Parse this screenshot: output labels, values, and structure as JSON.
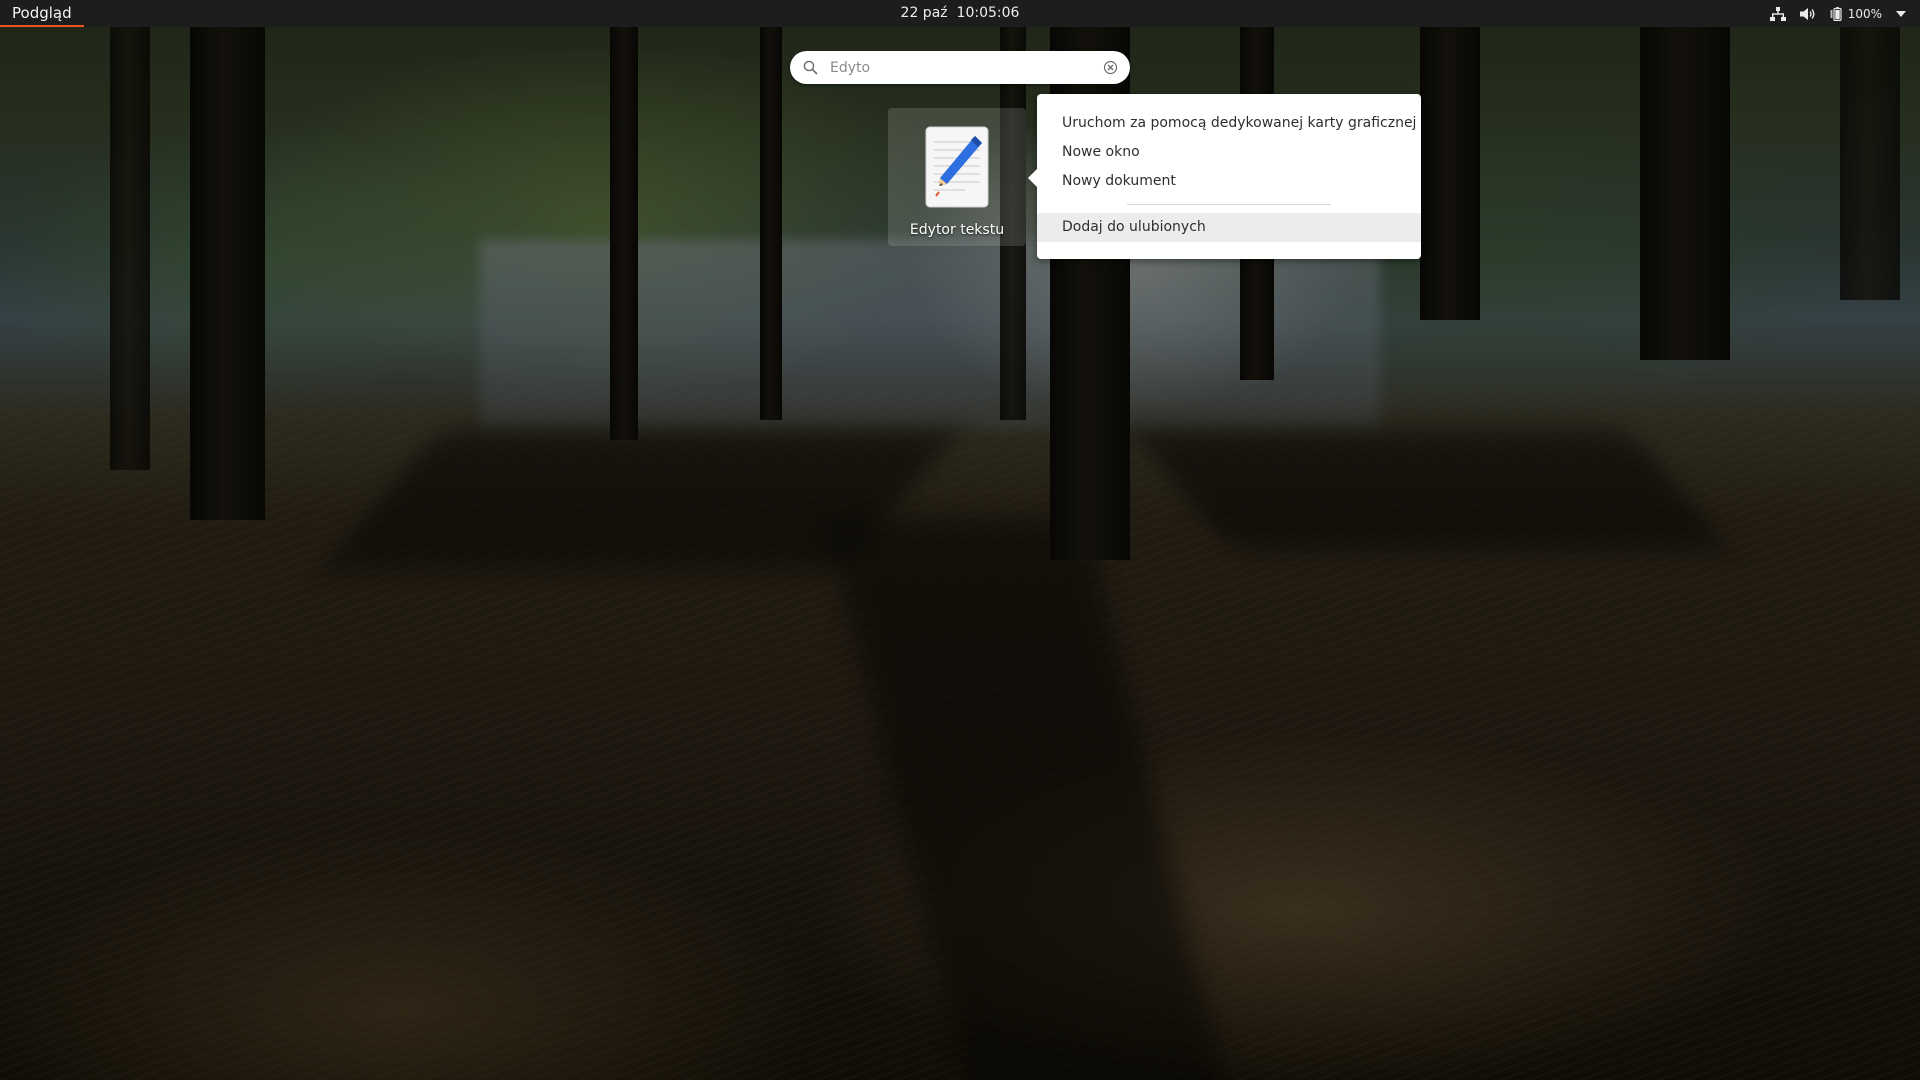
{
  "topbar": {
    "activities_label": "Podgląd",
    "clock_date": "22 paź",
    "clock_time": "10:05:06",
    "battery_percent": "100%",
    "icons": [
      "network-icon",
      "volume-icon",
      "battery-icon",
      "system-menu-arrow-icon"
    ]
  },
  "search": {
    "value": "Edyto",
    "icons": [
      "search-icon",
      "clear-icon"
    ]
  },
  "results": [
    {
      "label": "Edytor tekstu",
      "icon": "text-editor-icon"
    }
  ],
  "context_menu": {
    "items": [
      "Uruchom za pomocą dedykowanej karty graficznej",
      "Nowe okno",
      "Nowy dokument"
    ],
    "after_separator": [
      "Dodaj do ulubionych"
    ],
    "hovered_item": "Dodaj do ulubionych"
  },
  "colors": {
    "topbar_bg": "#1d1d1d",
    "accent": "#e95420",
    "menu_bg": "#ffffff",
    "menu_hover": "#ececec"
  }
}
